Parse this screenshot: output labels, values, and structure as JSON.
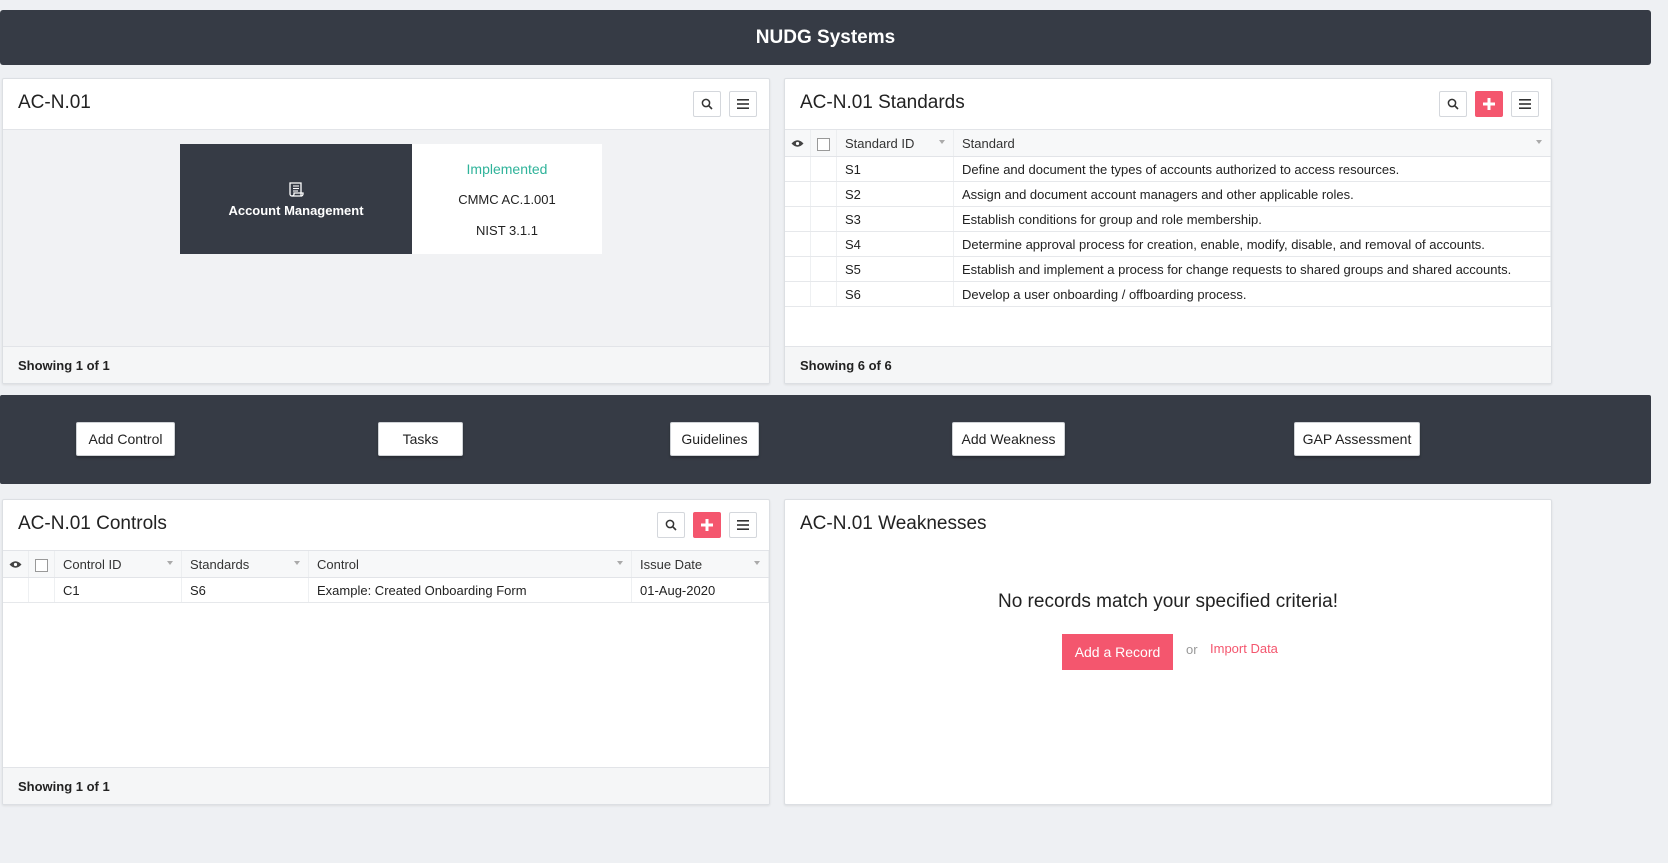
{
  "header": {
    "title": "NUDG Systems"
  },
  "control_panel": {
    "title": "AC-N.01",
    "card": {
      "name": "Account Management",
      "status": "Implemented",
      "ref1": "CMMC AC.1.001",
      "ref2": "NIST 3.1.1"
    },
    "footer": "Showing 1 of 1"
  },
  "standards_panel": {
    "title": "AC-N.01 Standards",
    "columns": [
      "Standard ID",
      "Standard"
    ],
    "rows": [
      {
        "id": "S1",
        "text": "Define and document the types of accounts authorized to access resources."
      },
      {
        "id": "S2",
        "text": "Assign and document account managers and other applicable roles."
      },
      {
        "id": "S3",
        "text": "Establish conditions for group and role membership."
      },
      {
        "id": "S4",
        "text": "Determine approval process for creation, enable, modify, disable, and removal of accounts."
      },
      {
        "id": "S5",
        "text": "Establish and implement a process for change requests to shared groups and shared accounts."
      },
      {
        "id": "S6",
        "text": "Develop a user onboarding / offboarding process."
      }
    ],
    "footer": "Showing 6 of 6"
  },
  "actions": {
    "add_control": "Add Control",
    "tasks": "Tasks",
    "guidelines": "Guidelines",
    "add_weakness": "Add Weakness",
    "gap_assessment": "GAP Assessment"
  },
  "controls_panel": {
    "title": "AC-N.01 Controls",
    "columns": [
      "Control ID",
      "Standards",
      "Control",
      "Issue Date"
    ],
    "rows": [
      {
        "id": "C1",
        "standards": "S6",
        "control": "Example: Created Onboarding Form",
        "date": "01-Aug-2020"
      }
    ],
    "footer": "Showing 1 of 1"
  },
  "weaknesses_panel": {
    "title": "AC-N.01 Weaknesses",
    "empty_message": "No records match your specified criteria!",
    "add_record": "Add a Record",
    "or": "or",
    "import": "Import Data"
  },
  "colors": {
    "dark": "#363b45",
    "accent": "#f4566e",
    "implemented": "#2fb39a"
  }
}
